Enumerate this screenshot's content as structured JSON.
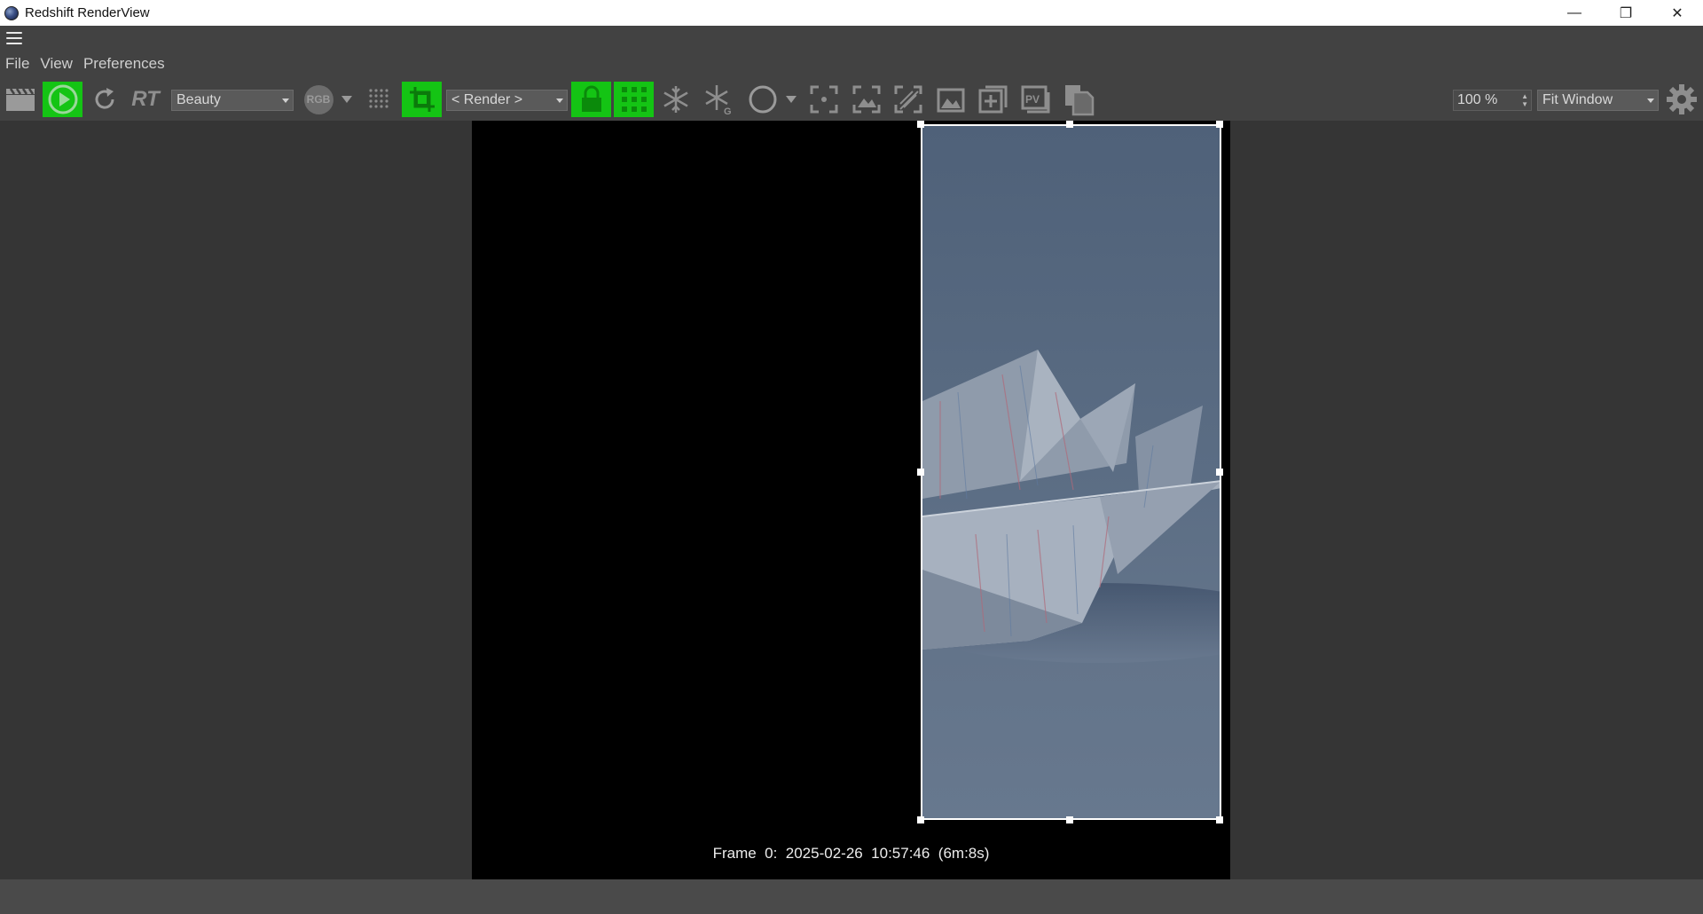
{
  "window": {
    "title": "Redshift RenderView",
    "controls": {
      "minimize": "—",
      "restore": "❐",
      "close": "✕"
    }
  },
  "menu": [
    "File",
    "View",
    "Preferences"
  ],
  "toolbar": {
    "rt_label": "RT",
    "aov_select": "Beauty",
    "channel_badge": "RGB",
    "camera_select": "< Render >",
    "zoom_value": "100 %",
    "fit_select": "Fit Window",
    "accent_color": "#14c414",
    "active_toggles": [
      "start-render",
      "region-crop",
      "lock",
      "grid"
    ]
  },
  "viewport": {
    "frame_info": "Frame  0:  2025-02-26  10:57:46  (6m:8s)"
  },
  "icons": [
    "hamburger-icon",
    "clapperboard-icon",
    "play-icon",
    "refresh-icon",
    "rgb-badge",
    "dot-grid-icon",
    "crop-icon",
    "lock-icon",
    "grid-icon",
    "snowflake-icon",
    "snowflake-g-icon",
    "circle-icon",
    "focus-icon",
    "fit-region-icon",
    "hatch-icon",
    "image-icon",
    "add-snapshot-icon",
    "pv-icon",
    "copy-icon",
    "gear-icon"
  ]
}
